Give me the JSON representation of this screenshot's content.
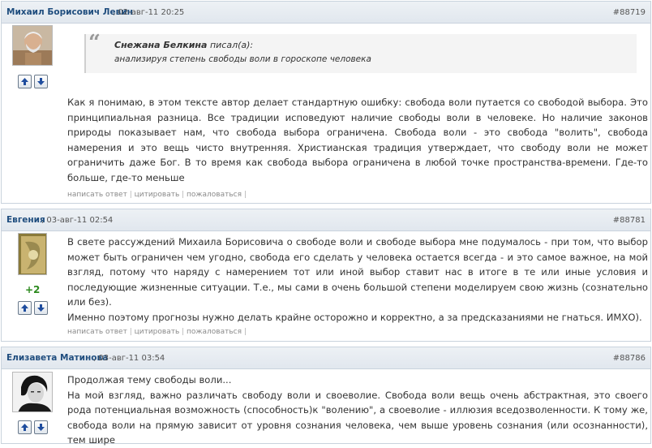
{
  "posts": [
    {
      "author": "Михаил Борисович Левин",
      "date": ", 02-авг-11 20:25",
      "post_id": "#88719",
      "avatar_icon": "user-photo-elderly-man",
      "quote": {
        "author": "Снежана Белкина",
        "wrote": " писал(а):",
        "text": "анализируя степень свободы воли в гороскопе человека"
      },
      "text": [
        "Как я понимаю, в этом тексте автор делает стандартную ошибку: свобода воли путается со свободой выбора. Это принципиальная разница. Все традиции исповедуют наличие свободы воли в человеке. Но наличие законов природы показывает нам, что свобода выбора ограничена. Свобода воли - это свобода \"волить\", свобода намерения и это вещь чисто внутренняя. Христианская традиция утверждает, что свободу воли не может ограничить даже Бог. В то время как свобода выбора ограничена в любой точке пространства-времени. Где-то больше, где-то меньше"
      ],
      "actions": [
        "написать ответ",
        "цитировать",
        "пожаловаться"
      ]
    },
    {
      "author": "Евгения",
      "date": ", 03-авг-11 02:54",
      "post_id": "#88781",
      "avatar_icon": "user-avatar-golden-card",
      "rating": "+2",
      "text": [
        "В свете рассуждений Михаила Борисовича о свободе воли и свободе выбора мне подумалось - при том, что выбор может быть ограничен чем угодно, свобода его сделать у человека остается всегда - и это самое важное, на мой взгляд, потому что наряду с намерением тот или иной выбор ставит нас в итоге в те или иные условия и последующие жизненные ситуации. Т.е., мы сами в очень большой степени моделируем свою жизнь (сознательно или без).",
        "Именно поэтому прогнозы нужно делать крайне осторожно и корректно, а за предсказаниями не гнаться. ИМХО)."
      ],
      "actions": [
        "написать ответ",
        "цитировать",
        "пожаловаться"
      ]
    },
    {
      "author": "Елизавета Матинова",
      "date": ", 03-авг-11 03:54",
      "post_id": "#88786",
      "avatar_icon": "user-photo-woman-bw",
      "text": [
        "Продолжая тему свободы воли...",
        "На мой взгляд, важно различать свободу воли и своеволие. Свобода воли вещь очень абстрактная, это своего рода потенциальная возможность (способность)к \"волению\", а своеволие - иллюзия вседозволенности. К тому же, свобода воли на прямую зависит от уровня сознания человека, чем выше уровень сознания (или осознанности), тем шире"
      ]
    }
  ],
  "vote": {
    "up_icon": "arrow-up-icon",
    "down_icon": "arrow-down-icon"
  },
  "separator": " | "
}
